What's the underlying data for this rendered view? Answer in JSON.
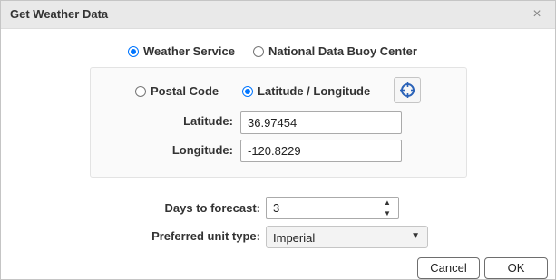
{
  "dialog": {
    "title": "Get Weather Data",
    "close_glyph": "×"
  },
  "source": {
    "options": [
      "Weather Service",
      "National Data Buoy Center"
    ],
    "selected": "Weather Service"
  },
  "location": {
    "modes": [
      "Postal Code",
      "Latitude / Longitude"
    ],
    "selected": "Latitude / Longitude",
    "locate_icon": "crosshair-icon",
    "latitude_label": "Latitude:",
    "latitude_value": "36.97454",
    "longitude_label": "Longitude:",
    "longitude_value": "-120.8229"
  },
  "forecast": {
    "days_label": "Days to forecast:",
    "days_value": "3",
    "unit_label": "Preferred unit type:",
    "unit_value": "Imperial"
  },
  "buttons": {
    "cancel": "Cancel",
    "ok": "OK"
  },
  "colors": {
    "radio_accent": "#0075ff",
    "title_bar": "#e9e9e9"
  }
}
